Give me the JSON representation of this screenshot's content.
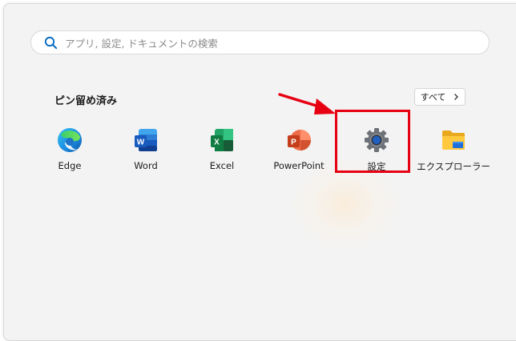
{
  "search": {
    "placeholder": "アプリ, 設定, ドキュメントの検索"
  },
  "pinned": {
    "title": "ピン留め済み",
    "all_label": "すべて",
    "apps": [
      {
        "label": "Edge",
        "icon": "edge-icon"
      },
      {
        "label": "Word",
        "icon": "word-icon"
      },
      {
        "label": "Excel",
        "icon": "excel-icon"
      },
      {
        "label": "PowerPoint",
        "icon": "powerpoint-icon"
      },
      {
        "label": "設定",
        "icon": "settings-gear-icon"
      },
      {
        "label": "エクスプローラー",
        "icon": "folder-icon"
      }
    ]
  },
  "colors": {
    "highlight": "#e60012",
    "search_icon": "#0067c0"
  }
}
